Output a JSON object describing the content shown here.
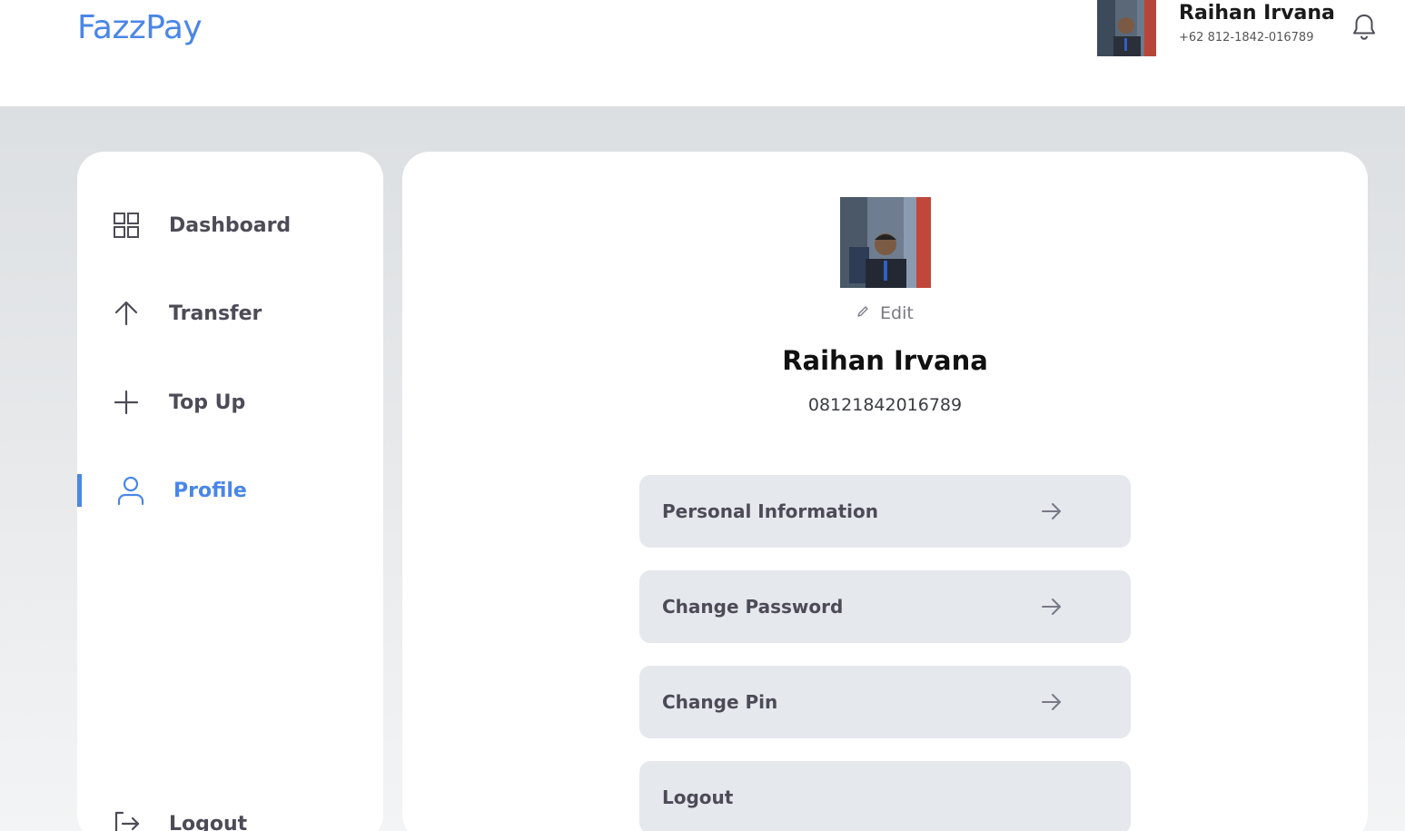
{
  "brand": {
    "name": "FazzPay"
  },
  "header": {
    "user_name": "Raihan Irvana",
    "user_phone": "+62 812-1842-016789",
    "notification_icon": "bell-icon"
  },
  "sidebar": {
    "items": [
      {
        "label": "Dashboard",
        "icon": "grid-icon",
        "active": false
      },
      {
        "label": "Transfer",
        "icon": "arrow-up-icon",
        "active": false
      },
      {
        "label": "Top Up",
        "icon": "plus-icon",
        "active": false
      },
      {
        "label": "Profile",
        "icon": "user-icon",
        "active": true
      }
    ],
    "logout_label": "Logout"
  },
  "profile": {
    "edit_label": "Edit",
    "name": "Raihan Irvana",
    "phone": "08121842016789",
    "menu": [
      {
        "label": "Personal Information",
        "arrow": true
      },
      {
        "label": "Change Password",
        "arrow": true
      },
      {
        "label": "Change Pin",
        "arrow": true
      },
      {
        "label": "Logout",
        "arrow": false
      }
    ]
  },
  "colors": {
    "accent": "#4a86e8",
    "text_dark": "#4d4b57",
    "menu_bg": "#e5e8ed"
  }
}
